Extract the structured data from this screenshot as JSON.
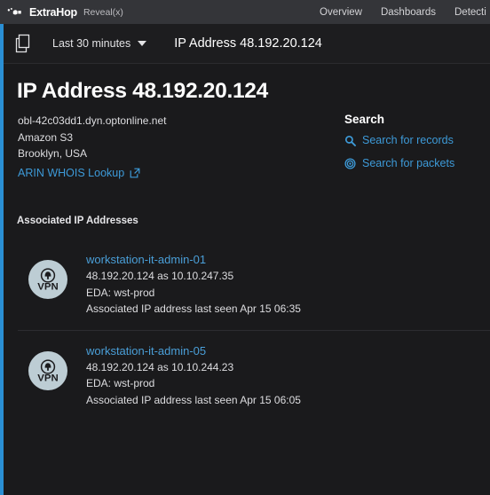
{
  "topbar": {
    "brand_name": "ExtraHop",
    "brand_sub": "Reveal(x)",
    "logo_icon": "extrahop-logo-icon",
    "nav": [
      {
        "label": "Overview"
      },
      {
        "label": "Dashboards"
      },
      {
        "label": "Detections"
      }
    ]
  },
  "toolbar": {
    "pages_icon": "pages-icon",
    "time_range": "Last 30 minutes",
    "caret_icon": "chevron-down-icon",
    "title": "IP Address 48.192.20.124"
  },
  "main": {
    "page_title": "IP Address 48.192.20.124",
    "meta": [
      "obl-42c03dd1.dyn.optonline.net",
      "Amazon S3",
      "Brooklyn, USA"
    ],
    "whois_link": "ARIN WHOIS Lookup",
    "whois_icon": "external-link-icon"
  },
  "search": {
    "heading": "Search",
    "items": [
      {
        "label": "Search for records",
        "icon": "magnifier-icon"
      },
      {
        "label": "Search for packets",
        "icon": "bullseye-icon"
      }
    ]
  },
  "associated": {
    "section_label": "Associated IP Addresses",
    "items": [
      {
        "icon": "vpn-device-icon",
        "icon_label": "VPN",
        "name": "workstation-it-admin-01",
        "mapping": "48.192.20.124 as 10.10.247.35",
        "eda": "EDA:  wst-prod",
        "last_seen": "Associated IP address last seen Apr 15 06:35"
      },
      {
        "icon": "vpn-device-icon",
        "icon_label": "VPN",
        "name": "workstation-it-admin-05",
        "mapping": "48.192.20.124 as 10.10.244.23",
        "eda": "EDA:  wst-prod",
        "last_seen": "Associated IP address last seen Apr 15 06:05"
      }
    ]
  },
  "colors": {
    "accent_blue": "#2a8fd4",
    "link_blue": "#3d9ad8",
    "background": "#1a1a1c",
    "topbar_bg": "#343539",
    "device_icon_bg": "#bdcdd4"
  }
}
